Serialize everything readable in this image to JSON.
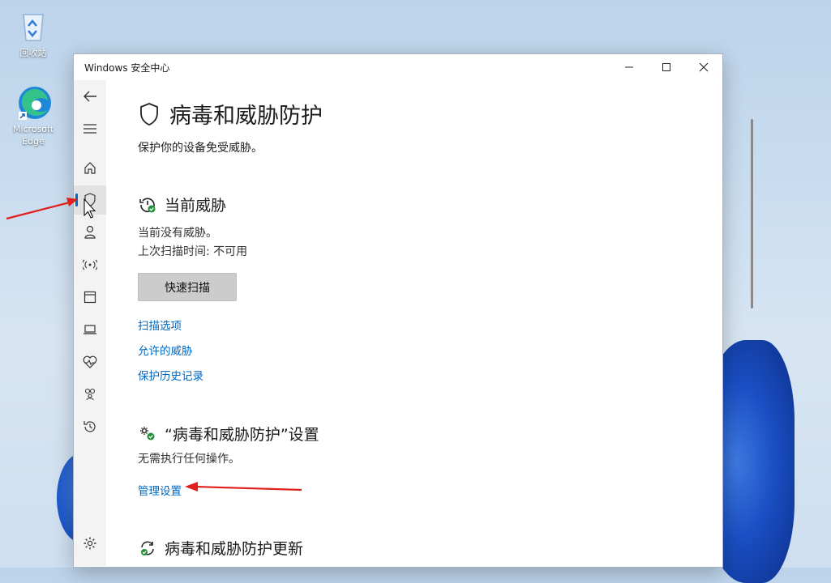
{
  "desktop": {
    "recycle_bin_label": "回收站",
    "edge_label": "Microsoft Edge"
  },
  "window": {
    "title": "Windows 安全中心"
  },
  "rail": {
    "items": [
      "back-icon",
      "menu-icon",
      "home-icon",
      "shield-icon",
      "account-icon",
      "network-icon",
      "app-browser-icon",
      "device-icon",
      "health-icon",
      "family-icon",
      "history-icon",
      "settings-icon"
    ],
    "active": "shield-icon"
  },
  "page": {
    "title": "病毒和威胁防护",
    "subtitle": "保护你的设备免受威胁。",
    "current_threats": {
      "title": "当前威胁",
      "status": "当前没有威胁。",
      "last_scan": "上次扫描时间: 不可用",
      "quick_scan_label": "快速扫描",
      "links": [
        "扫描选项",
        "允许的威胁",
        "保护历史记录"
      ]
    },
    "settings_section": {
      "title": "“病毒和威胁防护”设置",
      "status": "无需执行任何操作。",
      "manage_link": "管理设置"
    },
    "updates_section": {
      "title": "病毒和威胁防护更新"
    }
  },
  "colors": {
    "accent": "#0067c0",
    "annotation": "#e0201c",
    "status_ok": "#1f8f3a"
  }
}
